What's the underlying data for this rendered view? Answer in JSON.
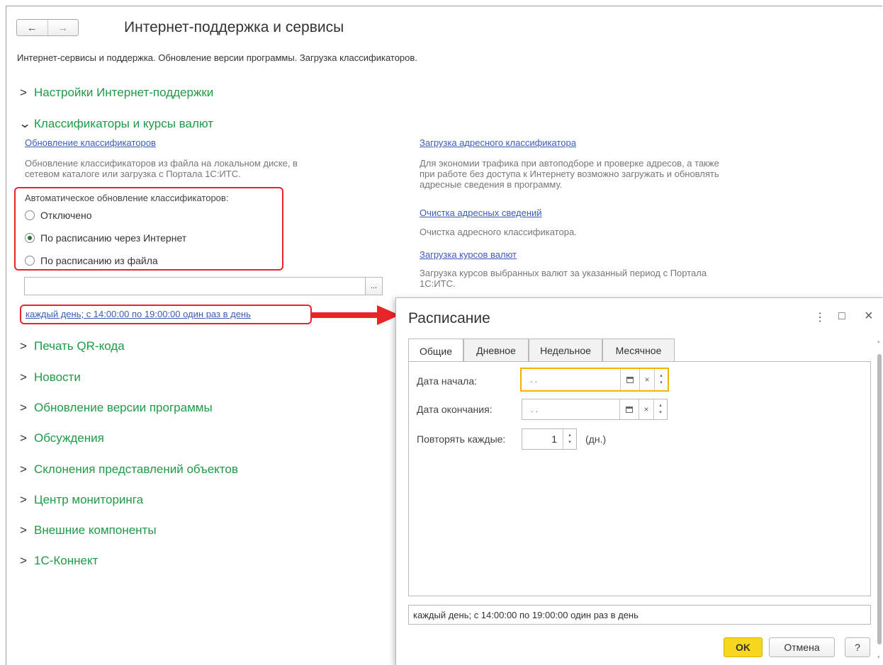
{
  "nav": {
    "back": "←",
    "forward": "→"
  },
  "page_title": "Интернет-поддержка и сервисы",
  "subtitle": "Интернет-сервисы и поддержка. Обновление версии программы. Загрузка классификаторов.",
  "groups": [
    "Настройки Интернет-поддержки",
    "Классификаторы и курсы валют",
    "Печать QR-кода",
    "Новости",
    "Обновление версии программы",
    "Обсуждения",
    "Склонения представлений объектов",
    "Центр мониторинга",
    "Внешние компоненты",
    "1С-Коннект"
  ],
  "chevrons": {
    "collapsed": ">",
    "expanded": "v"
  },
  "classifiers": {
    "update_link": "Обновление классификаторов",
    "update_desc_1": "Обновление классификаторов из файла на локальном диске, в",
    "update_desc_2": "сетевом каталоге или загрузка с Портала 1С:ИТС.",
    "auto_update_label": "Автоматическое обновление классификаторов:",
    "options": [
      "Отключено",
      "По расписанию через Интернет",
      "По расписанию из файла"
    ],
    "selected_option": "По расписанию через Интернет",
    "file_path_value": "",
    "browse_button": "...",
    "schedule_link": "каждый день; с 14:00:00 по 19:00:00 один раз в день"
  },
  "right_column": {
    "address_link": "Загрузка адресного классификатора",
    "address_desc_1": "Для экономии трафика при автоподборе и проверке адресов, а также",
    "address_desc_2": "при работе без доступа к Интернету возможно загружать и обновлять",
    "address_desc_3": "адресные сведения в программу.",
    "clear_link": "Очистка адресных сведений",
    "clear_desc": "Очистка адресного классификатора.",
    "rates_link": "Загрузка курсов валют",
    "rates_desc_1": "Загрузка курсов выбранных валют за указанный период с Портала",
    "rates_desc_2": "1С:ИТС."
  },
  "dialog": {
    "title": "Расписание",
    "menu_icon": "⋮",
    "maximize_icon": "□",
    "close_icon": "×",
    "tabs": [
      "Общие",
      "Дневное",
      "Недельное",
      "Месячное"
    ],
    "active_tab": "Общие",
    "start_date_label": "Дата начала:",
    "start_date_value": " .  .",
    "end_date_label": "Дата окончания:",
    "end_date_value": " .  .",
    "repeat_label": "Повторять каждые:",
    "repeat_value": "1",
    "repeat_unit": "(дн.)",
    "summary": "каждый день; с 14:00:00 по 19:00:00 один раз в день",
    "ok_button": "OK",
    "cancel_button": "Отмена",
    "help_button": "?"
  },
  "colors": {
    "group_green": "#1f9a46",
    "link_blue": "#3d5cb8",
    "highlight_red": "#e8262a",
    "ok_yellow": "#f7d71d",
    "focus_orange": "#f0b400"
  },
  "icons": [
    "back-arrow-icon",
    "forward-arrow-icon",
    "calendar-icon",
    "clear-icon",
    "spin-up-down-icon",
    "red-arrow-icon"
  ]
}
